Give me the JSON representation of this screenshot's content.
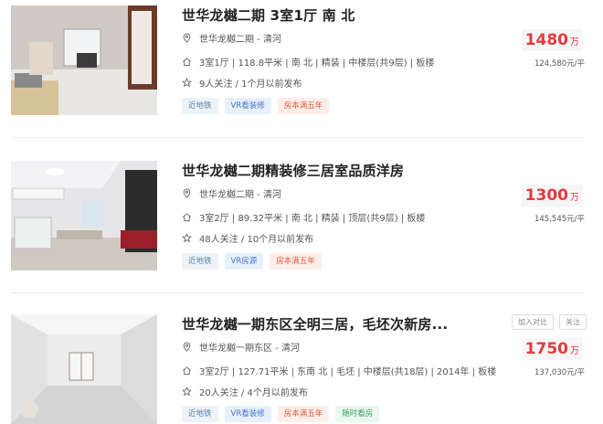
{
  "listings": [
    {
      "title": "世华龙樾二期 3室1厅 南 北",
      "community": "世华龙樾二期 - 清河",
      "details": "3室1厅 | 118.8平米 | 南 北 | 精装 | 中楼层(共9层) | 板楼",
      "follow": "9人关注 / 1个月以前发布",
      "tags": [
        "近地铁",
        "VR看装修",
        "房本满五年"
      ],
      "price": "1480",
      "price_unit": "万",
      "unit_price": "124,580元/平"
    },
    {
      "title": "世华龙樾二期精装修三居室品质洋房",
      "community": "世华龙樾二期 - 清河",
      "details": "3室2厅 | 89.32平米 | 南 北 | 精装 | 顶层(共9层) | 板楼",
      "follow": "48人关注 / 10个月以前发布",
      "tags": [
        "近地铁",
        "VR房源",
        "房本满五年"
      ],
      "price": "1300",
      "price_unit": "万",
      "unit_price": "145,545元/平"
    },
    {
      "title": "世华龙樾一期东区全明三居，毛坯次新房...",
      "community": "世华龙樾一期东区 - 清河",
      "details": "3室2厅 | 127.71平米 | 东南 北 | 毛坯 | 中楼层(共18层) | 2014年 | 板楼",
      "follow": "20人关注 / 4个月以前发布",
      "tags": [
        "近地铁",
        "VR看装修",
        "房本满五年",
        "随时看房"
      ],
      "price": "1750",
      "price_unit": "万",
      "unit_price": "137,030元/平",
      "compare_label": "加入对比",
      "follow_label": "关注"
    }
  ],
  "colors": {
    "price": "#e4393c",
    "tag_red": "#e15a3a",
    "tag_vr": "#3f76c7",
    "tag_green": "#39a363"
  },
  "icons": {
    "location": "location-pin-icon",
    "house": "house-icon",
    "star": "star-icon"
  }
}
